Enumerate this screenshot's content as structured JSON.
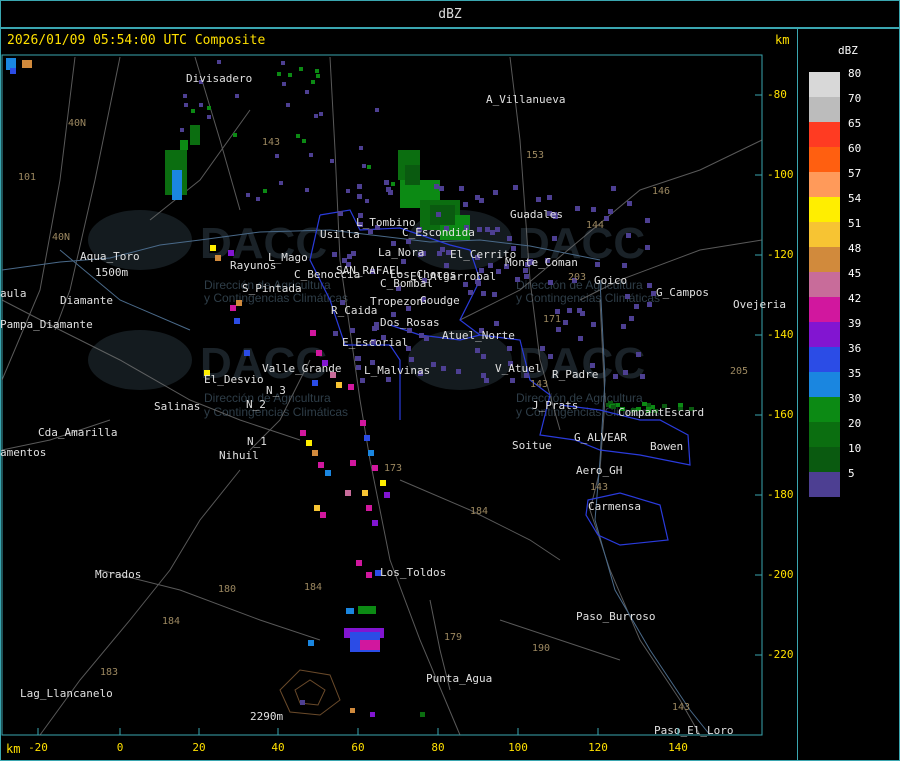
{
  "header": {
    "title": "dBZ"
  },
  "map": {
    "timestamp": "2026/01/09 05:54:00 UTC Composite",
    "unit_right": "km",
    "unit_bottom": "km",
    "y_ticks": [
      "-80",
      "-100",
      "-120",
      "-140",
      "-160",
      "-180",
      "-200",
      "-220"
    ],
    "x_ticks": [
      "-20",
      "0",
      "20",
      "40",
      "60",
      "80",
      "100",
      "120",
      "140"
    ],
    "places": [
      "Divisadero",
      "A_Villanueva",
      "Goudge",
      "Guadales",
      "L_Tombino",
      "C_Escondida",
      "Usilla",
      "La_Nora",
      "El_Cerrito",
      "Aqua_Toro",
      "Rayunos",
      "L_Mago",
      "C_Benoccia",
      "SAN_RAFAEL",
      "Los_Chocos",
      "C_Bombal",
      "El_Algarrobal",
      "Monte_Coman",
      "Goico",
      "G_Campos",
      "Ovejeria",
      "S_Pintada",
      "Pampa_Diamante",
      "aula",
      "R_Caida",
      "Tropezon",
      "Goudge",
      "Dos_Rosas",
      "Atuel_Norte",
      "E_Escorial",
      "Valle_Grande",
      "L_Malvinas",
      "V_Atuel",
      "R_Padre",
      "El_Desvio",
      "Salinas",
      "J_Prats",
      "CompantEscard",
      "G_ALVEAR",
      "Bowen",
      "Cda_Amarilla",
      "N_1",
      "Nihuil",
      "N_2",
      "N_3",
      "Soitue",
      "Aero_GH",
      "Carmensa",
      "amentos",
      "Morados",
      "Los_Toldos",
      "Paso_Burroso",
      "Punta_Agua",
      "Lag_Llancanelo",
      "Paso_El_Loro",
      "1500m",
      "2290m",
      "Diamante"
    ],
    "route_numbers": [
      "143",
      "101",
      "40N",
      "153",
      "146",
      "144",
      "203",
      "171",
      "143",
      "173",
      "184",
      "180",
      "184",
      "183",
      "184",
      "179",
      "190",
      "143",
      "205",
      "40N",
      "143"
    ],
    "watermark": {
      "brand": "DACC",
      "line1": "Dirección de Agricultura",
      "line2": "y Contingencias Climáticas",
      "url": "http://www.contingencias.mendoza.gov.ar"
    }
  },
  "legend": {
    "title": "dBZ",
    "levels": [
      {
        "value": "80",
        "color": "#d8d8d8"
      },
      {
        "value": "70",
        "color": "#bcbcbc"
      },
      {
        "value": "65",
        "color": "#ff3b22"
      },
      {
        "value": "60",
        "color": "#ff5f10"
      },
      {
        "value": "57",
        "color": "#ff9a5a"
      },
      {
        "value": "54",
        "color": "#ffee00"
      },
      {
        "value": "51",
        "color": "#f7c433"
      },
      {
        "value": "48",
        "color": "#d18a3c"
      },
      {
        "value": "45",
        "color": "#c86c9a"
      },
      {
        "value": "42",
        "color": "#d1179e"
      },
      {
        "value": "39",
        "color": "#8215d1"
      },
      {
        "value": "36",
        "color": "#2b4ce6"
      },
      {
        "value": "35",
        "color": "#1a86e0"
      },
      {
        "value": "30",
        "color": "#0c8a14"
      },
      {
        "value": "20",
        "color": "#0b6e10"
      },
      {
        "value": "10",
        "color": "#0a5a10"
      },
      {
        "value": "5",
        "color": "#4d3f92"
      }
    ]
  }
}
